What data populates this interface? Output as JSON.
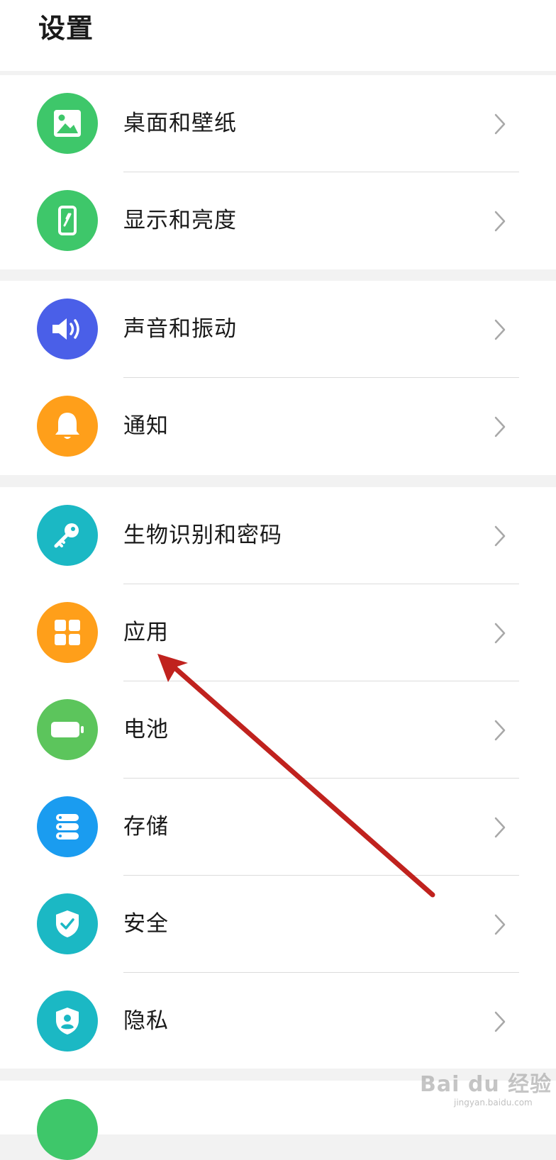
{
  "page": {
    "title": "设置"
  },
  "groups": [
    {
      "items": [
        {
          "label": "桌面和壁纸",
          "icon": "wallpaper-icon",
          "color": "#3ec76a"
        },
        {
          "label": "显示和亮度",
          "icon": "display-brightness-icon",
          "color": "#3ec76a"
        }
      ]
    },
    {
      "items": [
        {
          "label": "声音和振动",
          "icon": "sound-icon",
          "color": "#4a5fe8"
        },
        {
          "label": "通知",
          "icon": "bell-icon",
          "color": "#ff9f1a"
        }
      ]
    },
    {
      "items": [
        {
          "label": "生物识别和密码",
          "icon": "key-icon",
          "color": "#1bb8c4"
        },
        {
          "label": "应用",
          "icon": "apps-grid-icon",
          "color": "#ff9f1a"
        },
        {
          "label": "电池",
          "icon": "battery-icon",
          "color": "#5cc55c"
        },
        {
          "label": "存储",
          "icon": "storage-icon",
          "color": "#1a9cf0"
        },
        {
          "label": "安全",
          "icon": "shield-check-icon",
          "color": "#1bb8c4"
        },
        {
          "label": "隐私",
          "icon": "privacy-icon",
          "color": "#1bb8c4"
        }
      ]
    }
  ],
  "annotation": {
    "color": "#c0221e"
  },
  "watermark": {
    "text": "Bai du 经验",
    "sub": "jingyan.baidu.com"
  }
}
